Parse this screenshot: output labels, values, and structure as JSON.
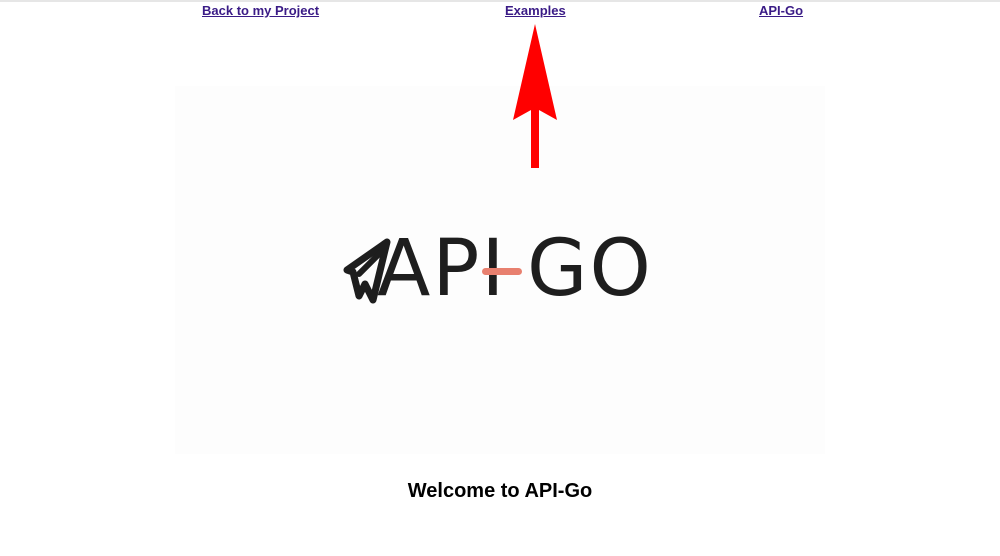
{
  "nav": {
    "back_label": "Back to my Project",
    "examples_label": "Examples",
    "apigo_label": "API-Go"
  },
  "logo": {
    "text_left": "API",
    "text_right": "GO",
    "mark_icon": "paper-plane-icon",
    "accent_color": "#e8806f",
    "text_color": "#1e1e1e"
  },
  "annotation": {
    "arrow_icon": "red-arrow-up-icon",
    "color": "#ff0000"
  },
  "main": {
    "welcome_text": "Welcome to API-Go"
  },
  "colors": {
    "link": "#3a1b86",
    "hero_background": "#fdfdfd"
  }
}
